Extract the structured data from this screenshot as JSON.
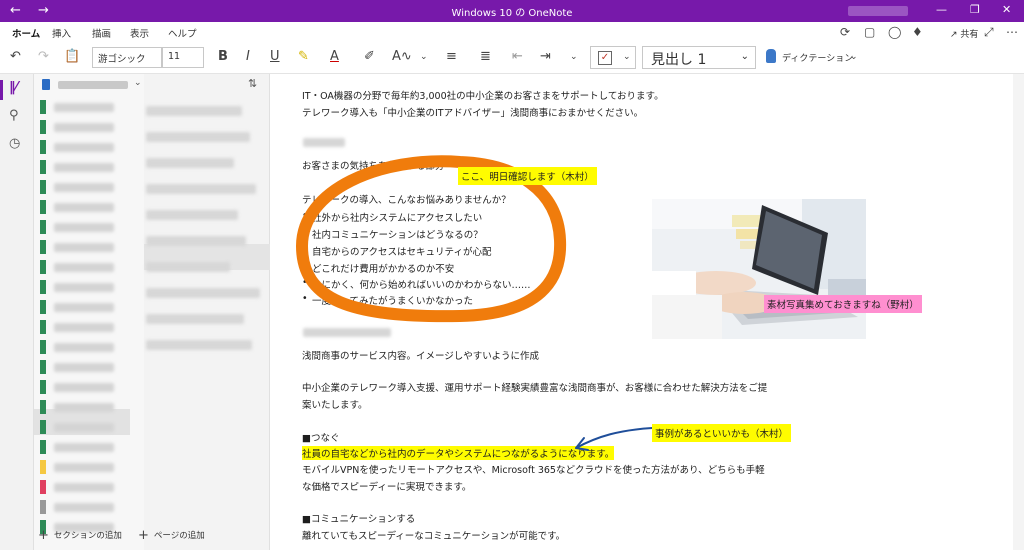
{
  "window": {
    "title": "Windows 10 の OneNote"
  },
  "ribbon": {
    "tabs": [
      "ホーム",
      "挿入",
      "描画",
      "表示",
      "ヘルプ"
    ],
    "share_label": "共有",
    "font_name": "游ゴシック",
    "font_size": "11",
    "style": "見出し 1",
    "dictation_label": "ディクテーション"
  },
  "sidebar": {
    "section_colors": [
      "#2e8b57",
      "#2e8b57",
      "#2e8b57",
      "#2e8b57",
      "#2e8b57",
      "#2e8b57",
      "#2e8b57",
      "#2e8b57",
      "#2e8b57",
      "#2e8b57",
      "#2e8b57",
      "#2e8b57",
      "#2e8b57",
      "#2e8b57",
      "#2e8b57",
      "#2e8b57",
      "#2e8b57",
      "#2e8b57",
      "#f5c842",
      "#e04060",
      "#999999",
      "#2e8b57"
    ],
    "add_section": "セクションの追加",
    "add_page": "ページの追加"
  },
  "note": {
    "intro_1": "IT・OA機器の分野で毎年約3,000社の中小企業のお客さまをサポートしております。",
    "intro_2": "テレワーク導入も「中小企業のITアドバイザー」浅間商事におまかせください。",
    "section_label": "お客さまの気持ちを代弁する部分",
    "question": "テレワークの導入、こんなお悩みありませんか？",
    "bullets": [
      "社外から社内システムにアクセスしたい",
      "社内コミュニケーションはどうなるの？",
      "自宅からのアクセスはセキュリティが心配",
      "どこれだけ費用がかかるのか不安",
      "とにかく、何から始めればいいのかわからない……",
      "一度やってみたがうまくいかなかった"
    ],
    "service_line": "浅間商事のサービス内容。イメージしやすいように作成",
    "service_body_1": "中小企業のテレワーク導入支援、運用サポート経験実績豊富な浅間商事が、お客様に合わせた解決方法をご提",
    "service_body_2": "案いたします。",
    "connect_heading": "■つなぐ",
    "connect_highlight": "社員の自宅などから社内のデータやシステムにつながるようになります。",
    "connect_body_1": "モバイルVPNを使ったリモートアクセスや、Microsoft 365などクラウドを使った方法があり、どちらも手軽",
    "connect_body_2": "な価格でスピーディーに実現できます。",
    "comm_heading": "■コミュニケーションする",
    "comm_body": "離れていてもスピーディーなコミュニケーションが可能です。"
  },
  "annotations": {
    "kimura_confirm": "ここ、明日確認します（木村）",
    "nomura_photo": "素材写真集めておきますね（野村）",
    "kimura_example": "事例があるといいかも（木村）"
  },
  "colors": {
    "accent": "#7719aa",
    "ink_orange": "#f07c0c",
    "ink_blue": "#1f4e9a",
    "highlight_yellow": "#fffc00",
    "highlight_pink": "#ff8fd0"
  }
}
